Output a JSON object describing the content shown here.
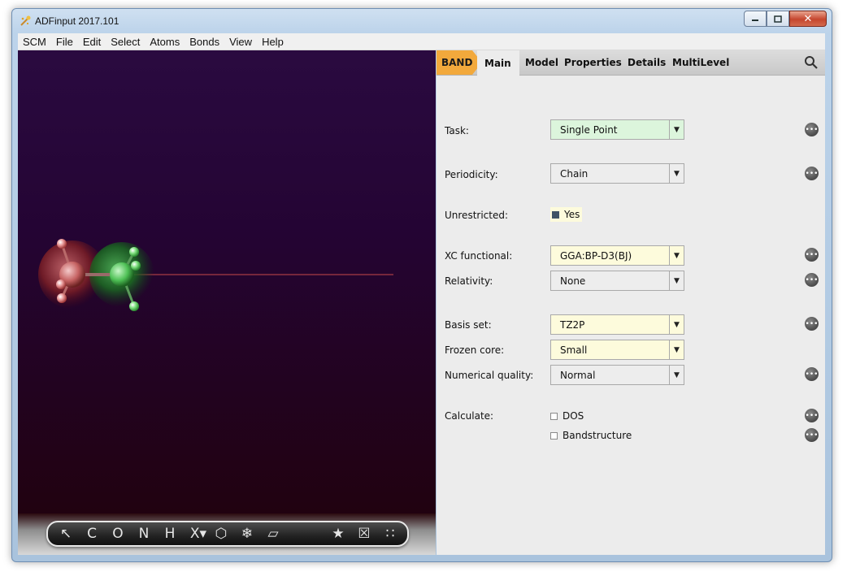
{
  "window": {
    "title": "ADFinput 2017.101"
  },
  "menu": [
    "SCM",
    "File",
    "Edit",
    "Select",
    "Atoms",
    "Bonds",
    "View",
    "Help"
  ],
  "toolbar": {
    "tools": [
      {
        "name": "select-tool",
        "glyph": "↖"
      },
      {
        "name": "carbon-tool",
        "glyph": "C"
      },
      {
        "name": "oxygen-tool",
        "glyph": "O"
      },
      {
        "name": "nitrogen-tool",
        "glyph": "N"
      },
      {
        "name": "hydrogen-tool",
        "glyph": "H"
      },
      {
        "name": "other-element-tool",
        "glyph": "X▾"
      },
      {
        "name": "ring-tool",
        "glyph": "⬡"
      },
      {
        "name": "freeze-tool",
        "glyph": "❄"
      },
      {
        "name": "plane-tool",
        "glyph": "▱"
      },
      {
        "name": "favorites-tool",
        "glyph": "★"
      },
      {
        "name": "cell-tool",
        "glyph": "☒"
      },
      {
        "name": "structures-tool",
        "glyph": "∷"
      }
    ]
  },
  "tabs": {
    "engine": "BAND",
    "items": [
      "Main",
      "Model",
      "Properties",
      "Details",
      "MultiLevel"
    ],
    "active": "Main"
  },
  "form": {
    "task": {
      "label": "Task:",
      "value": "Single Point"
    },
    "periodicity": {
      "label": "Periodicity:",
      "value": "Chain"
    },
    "unrestricted": {
      "label": "Unrestricted:",
      "option": "Yes"
    },
    "xc": {
      "label": "XC functional:",
      "value": "GGA:BP-D3(BJ)"
    },
    "relativity": {
      "label": "Relativity:",
      "value": "None"
    },
    "basis": {
      "label": "Basis set:",
      "value": "TZ2P"
    },
    "frozen": {
      "label": "Frozen core:",
      "value": "Small"
    },
    "quality": {
      "label": "Numerical quality:",
      "value": "Normal"
    },
    "calculate": {
      "label": "Calculate:",
      "dos": "DOS",
      "bands": "Bandstructure"
    }
  },
  "colors": {
    "band_tab": "#f2a93c",
    "task_bg": "#dcf5dc",
    "highlight_bg": "#fdfbdc",
    "viewport_top": "#2a0a40",
    "viewport_bottom": "#210210"
  }
}
